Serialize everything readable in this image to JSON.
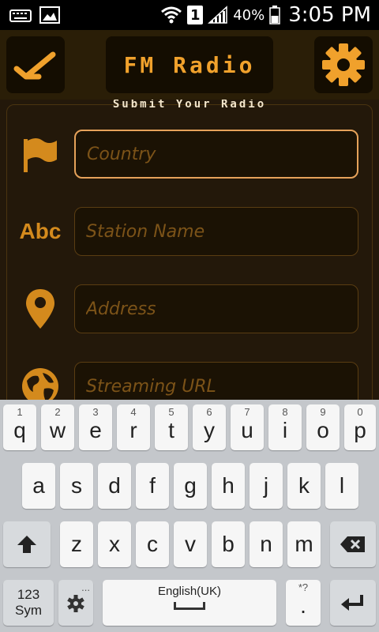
{
  "status_bar": {
    "sim_slot": "1",
    "battery": "40%",
    "time": "3:05 PM"
  },
  "header": {
    "title": "FM Radio",
    "back_icon": "back-arrow-icon",
    "settings_icon": "gear-icon"
  },
  "form": {
    "heading": "Submit Your Radio",
    "fields": [
      {
        "icon": "flag-icon",
        "placeholder": "Country",
        "value": ""
      },
      {
        "icon": "abc-text-icon",
        "icon_text": "Abc",
        "placeholder": "Station Name",
        "value": ""
      },
      {
        "icon": "location-pin-icon",
        "placeholder": "Address",
        "value": ""
      },
      {
        "icon": "globe-icon",
        "placeholder": "Streaming URL",
        "value": ""
      }
    ]
  },
  "colors": {
    "accent": "#f0a12c",
    "header_bg": "#2a1e07",
    "form_bg": "#23180a",
    "keyboard_bg": "#c4c7cb"
  },
  "keyboard": {
    "row1": [
      {
        "key": "q",
        "hint": "1"
      },
      {
        "key": "w",
        "hint": "2"
      },
      {
        "key": "e",
        "hint": "3"
      },
      {
        "key": "r",
        "hint": "4"
      },
      {
        "key": "t",
        "hint": "5"
      },
      {
        "key": "y",
        "hint": "6"
      },
      {
        "key": "u",
        "hint": "7"
      },
      {
        "key": "i",
        "hint": "8"
      },
      {
        "key": "o",
        "hint": "9"
      },
      {
        "key": "p",
        "hint": "0"
      }
    ],
    "row2": [
      "a",
      "s",
      "d",
      "f",
      "g",
      "h",
      "j",
      "k",
      "l"
    ],
    "row3": [
      "z",
      "x",
      "c",
      "v",
      "b",
      "n",
      "m"
    ],
    "sym_label_top": "123",
    "sym_label_bottom": "Sym",
    "space_label": "English(UK)",
    "period_key": ".",
    "period_hint": "*?",
    "mic_hint": "..."
  }
}
